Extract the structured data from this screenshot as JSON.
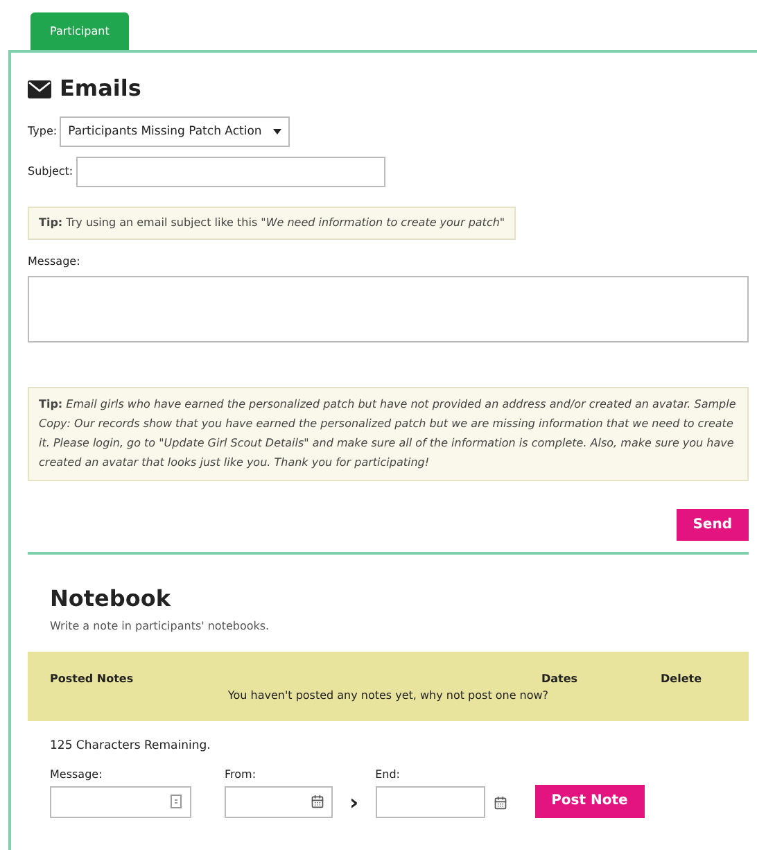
{
  "tabs": [
    {
      "label": "Participant",
      "selected": true
    }
  ],
  "emails": {
    "title": "Emails",
    "type_label": "Type:",
    "type_value": "Participants Missing Patch Action",
    "subject_label": "Subject:",
    "tip1": "**Tip:** Try using an email subject like this *\"We need information to create your patch\"*",
    "message_label": "Message:",
    "tip2": "**Tip:** *Email girls who have earned the personalized patch but have not provided an address and/or created an avatar. Sample Copy: Our records show that you have earned the personalized patch but we are missing information that we need to create it. Please login, go to \"Update Girl Scout Details\" and make sure all of the information is complete. Also, make sure you have created an avatar that looks just like you. Thank you for participating!*",
    "send": "Send"
  },
  "notebook": {
    "title": "Notebook",
    "subtitle": "Write a note in participants' notebooks.",
    "columns": [
      "Posted Notes",
      "Dates",
      "Delete"
    ],
    "empty": "You haven't posted any notes yet, why not post one now?",
    "remaining": "125 Characters Remaining.",
    "message_label": "Message:",
    "from_label": "From:",
    "end_label": "End:",
    "arrow": "›",
    "post": "Post Note"
  }
}
